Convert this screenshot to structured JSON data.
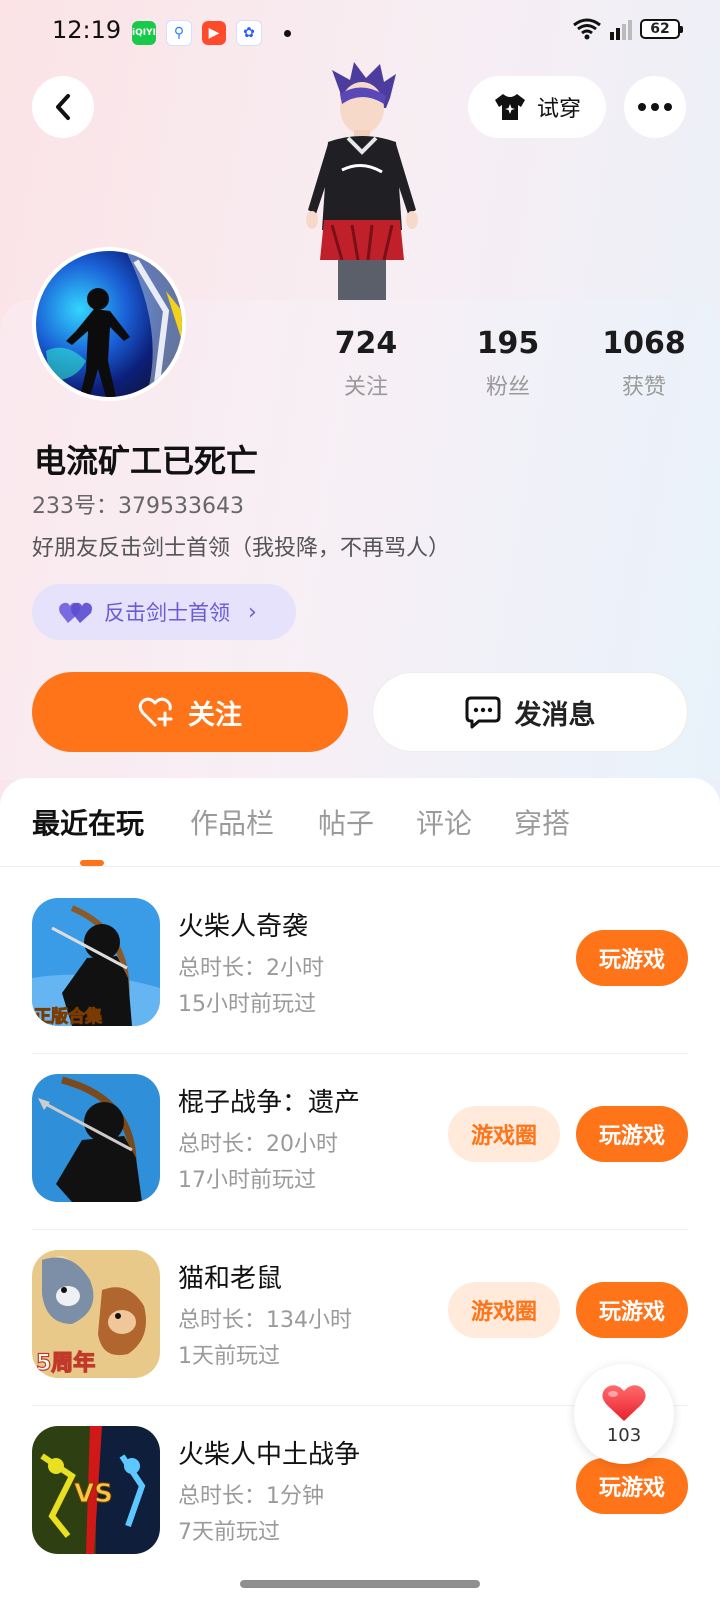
{
  "status_bar": {
    "time": "12:19",
    "battery": "62",
    "app_iqiyi": "iQIYI"
  },
  "header": {
    "try_on_label": "试穿"
  },
  "profile": {
    "stats": [
      {
        "value": "724",
        "label": "关注"
      },
      {
        "value": "195",
        "label": "粉丝"
      },
      {
        "value": "1068",
        "label": "获赞"
      }
    ],
    "username": "电流矿工已死亡",
    "uid": "233号：379533643",
    "bio": "好朋友反击剑士首领（我投降，不再骂人）",
    "tag_label": "反击剑士首领",
    "follow_label": "关注",
    "message_label": "发消息"
  },
  "tabs": [
    {
      "label": "最近在玩",
      "active": true
    },
    {
      "label": "作品栏",
      "active": false
    },
    {
      "label": "帖子",
      "active": false
    },
    {
      "label": "评论",
      "active": false
    },
    {
      "label": "穿搭",
      "active": false
    }
  ],
  "games": [
    {
      "title": "火柴人奇袭",
      "total_time": "总时长：2小时",
      "last_played": "15小时前玩过",
      "play_label": "玩游戏",
      "icon_text": "正版合集"
    },
    {
      "title": "棍子战争：遗产",
      "total_time": "总时长：20小时",
      "last_played": "17小时前玩过",
      "circle_label": "游戏圈",
      "play_label": "玩游戏"
    },
    {
      "title": "猫和老鼠",
      "total_time": "总时长：134小时",
      "last_played": "1天前玩过",
      "circle_label": "游戏圈",
      "play_label": "玩游戏",
      "icon_text": "5周年"
    },
    {
      "title": "火柴人中土战争",
      "total_time": "总时长：1分钟",
      "last_played": "7天前玩过",
      "play_label": "玩游戏",
      "icon_text": "VS"
    }
  ],
  "like_button": {
    "count": "103"
  },
  "colors": {
    "accent": "#ff7419",
    "tag_bg": "#e6e2fb",
    "tag_text": "#6a5ad6"
  }
}
